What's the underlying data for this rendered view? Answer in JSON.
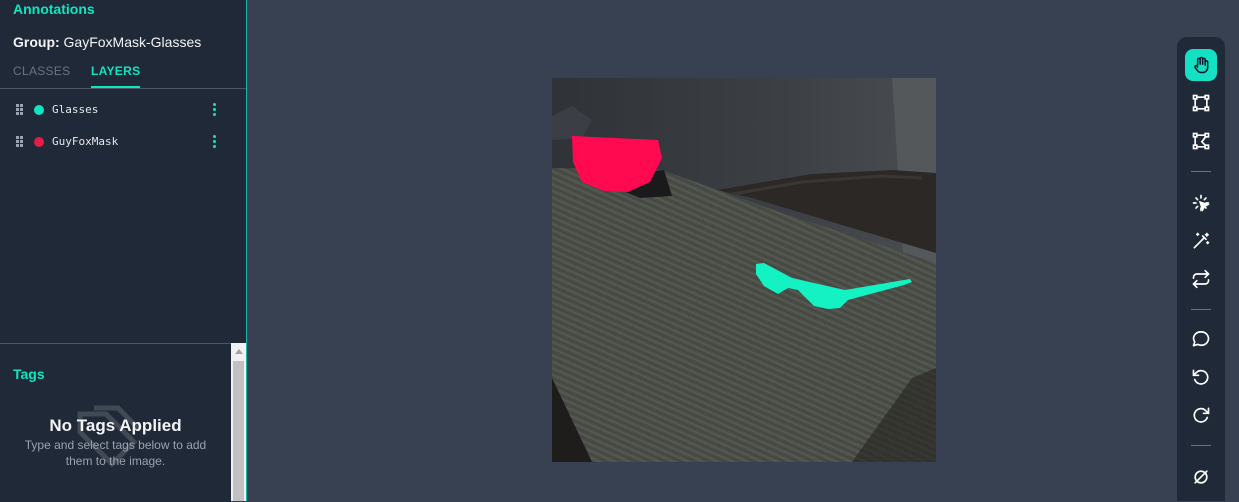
{
  "panel": {
    "title": "Annotations",
    "group_label": "Group:",
    "group_name": "GayFoxMask-Glasses",
    "tabs": [
      "CLASSES",
      "LAYERS"
    ],
    "active_tab": "LAYERS"
  },
  "layers": [
    {
      "name": "Glasses",
      "color": "#10e5c2"
    },
    {
      "name": "GuyFoxMask",
      "color": "#e11d48"
    }
  ],
  "tags": {
    "title": "Tags",
    "empty_title": "No Tags Applied",
    "empty_help": "Type and select tags below to add them to the image."
  },
  "toolbar": {
    "tools": [
      "hand-icon",
      "bounding-box-icon",
      "polygon-icon",
      "smart-select-icon",
      "magic-wand-icon",
      "repeat-icon",
      "comment-icon",
      "undo-icon",
      "redo-icon",
      "null-icon"
    ],
    "active": "hand-icon"
  },
  "colors": {
    "accent": "#10e5c2",
    "mask": "#ff0a50",
    "glasses": "#14f2c3"
  }
}
